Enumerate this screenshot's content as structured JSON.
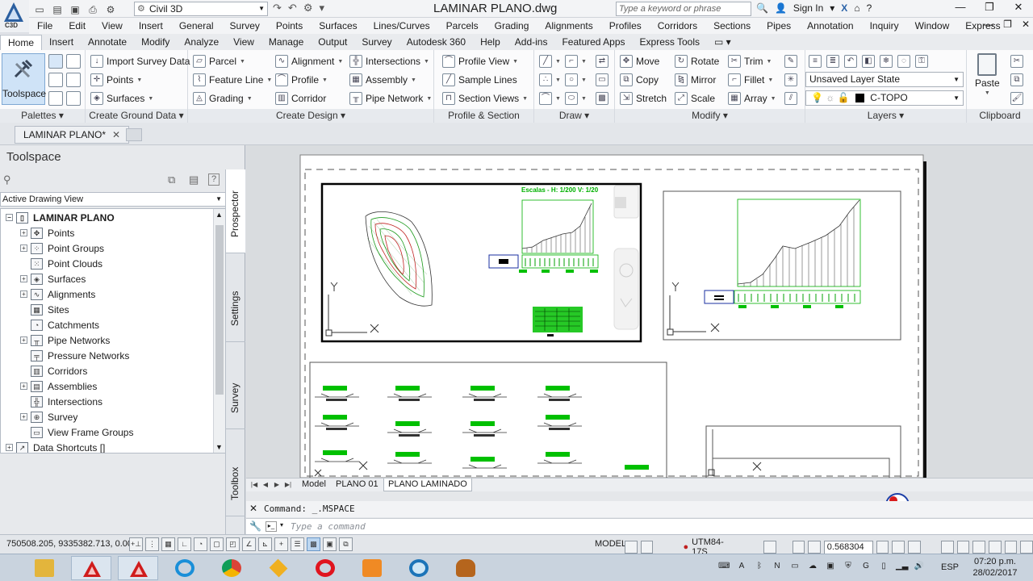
{
  "title": {
    "app_tag": "C3D",
    "workspace": "Civil 3D",
    "document": "LAMINAR PLANO.dwg",
    "search_placeholder": "Type a keyword or phrase",
    "sign_in": "Sign In"
  },
  "menu": [
    "File",
    "Edit",
    "View",
    "Insert",
    "General",
    "Survey",
    "Points",
    "Surfaces",
    "Lines/Curves",
    "Parcels",
    "Grading",
    "Alignments",
    "Profiles",
    "Corridors",
    "Sections",
    "Pipes",
    "Annotation",
    "Inquiry",
    "Window",
    "Express"
  ],
  "ribbon_tabs": [
    "Home",
    "Insert",
    "Annotate",
    "Modify",
    "Analyze",
    "View",
    "Manage",
    "Output",
    "Survey",
    "Autodesk 360",
    "Help",
    "Add-ins",
    "Featured Apps",
    "Express Tools"
  ],
  "ribbon": {
    "palettes": {
      "title": "Palettes",
      "toolspace": "Toolspace"
    },
    "ground": {
      "title": "Create Ground Data",
      "items": [
        "Import Survey Data",
        "Points",
        "Surfaces"
      ]
    },
    "design": {
      "title": "Create Design",
      "col1": [
        "Parcel",
        "Feature Line",
        "Grading"
      ],
      "col2": [
        "Alignment",
        "Profile",
        "Corridor"
      ],
      "col3": [
        "Intersections",
        "Assembly",
        "Pipe Network"
      ]
    },
    "profile": {
      "title": "Profile & Section Views",
      "items": [
        "Profile View",
        "Sample Lines",
        "Section Views"
      ]
    },
    "draw": {
      "title": "Draw"
    },
    "modify": {
      "title": "Modify",
      "col1": [
        "Move",
        "Copy",
        "Stretch"
      ],
      "col2": [
        "Rotate",
        "Mirror",
        "Scale"
      ],
      "col3": [
        "Trim",
        "Fillet",
        "Array"
      ]
    },
    "layers": {
      "title": "Layers",
      "state": "Unsaved Layer State",
      "current": "C-TOPO"
    },
    "clipboard": {
      "title": "Clipboard",
      "paste": "Paste"
    }
  },
  "doc_tab": "LAMINAR PLANO*",
  "toolspace": {
    "title": "Toolspace",
    "view": "Active Drawing View",
    "root": "LAMINAR PLANO",
    "items": [
      "Points",
      "Point Groups",
      "Point Clouds",
      "Surfaces",
      "Alignments",
      "Sites",
      "Catchments",
      "Pipe Networks",
      "Pressure Networks",
      "Corridors",
      "Assemblies",
      "Intersections",
      "Survey",
      "View Frame Groups"
    ],
    "shortcuts": "Data Shortcuts []",
    "vtabs": [
      "Prospector",
      "Settings",
      "Survey",
      "Toolbox"
    ]
  },
  "drawing": {
    "profile_title": "Escalas - H: 1/200 V: 1/20"
  },
  "layout_tabs": [
    "Model",
    "PLANO 01",
    "PLANO LAMINADO"
  ],
  "command": {
    "history": "Command:  _.MSPACE",
    "placeholder": "Type a command"
  },
  "status": {
    "coords": "750508.205, 9335382.713, 0.000",
    "model": "MODEL",
    "coord_system": "UTM84-17S",
    "scale": "0.568304"
  },
  "taskbar": {
    "lang": "ESP",
    "time": "07:20 p.m.",
    "date": "28/02/2017"
  },
  "colors": {
    "accent": "#1f5fa8",
    "cad_green": "#00c000",
    "paper": "#ffffff",
    "canvas": "#d9dcdf"
  }
}
